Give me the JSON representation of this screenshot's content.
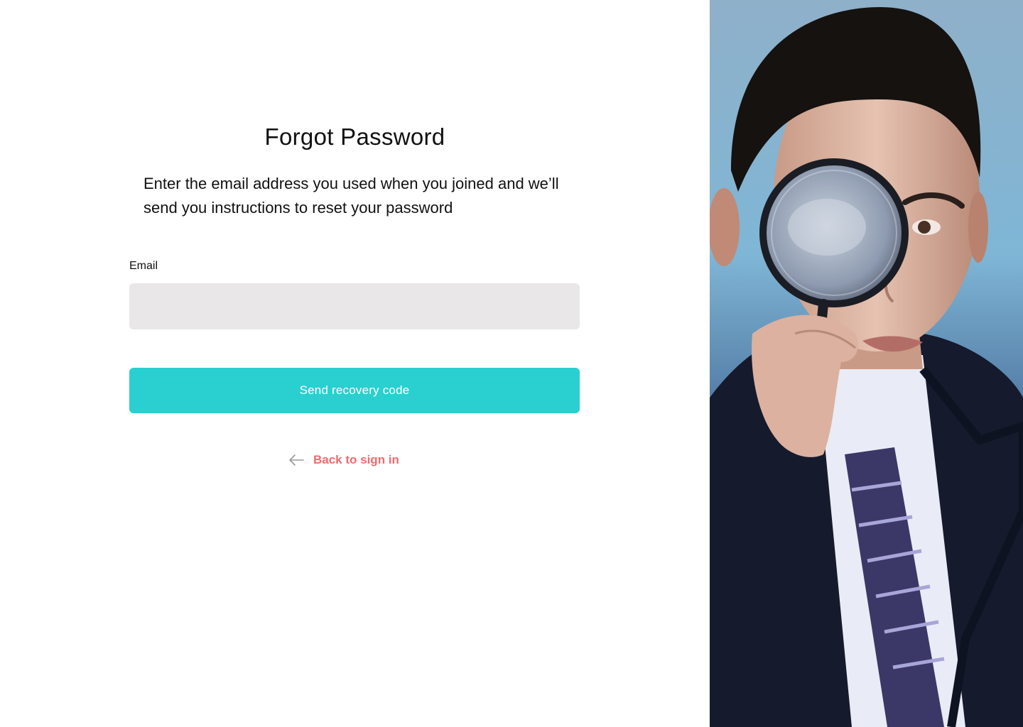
{
  "form": {
    "title": "Forgot Password",
    "subtitle": "Enter the email address you used when you joined and we’ll send you instructions to reset your password",
    "email_label": "Email",
    "email_value": "",
    "email_placeholder": "",
    "submit_label": "Send recovery code",
    "back_link_label": "Back to sign in"
  },
  "icons": {
    "back": "arrow-left-icon"
  },
  "colors": {
    "accent": "#29d0cf",
    "link": "#ee6c6f",
    "input_background": "#e9e7e8",
    "text": "#111111"
  }
}
